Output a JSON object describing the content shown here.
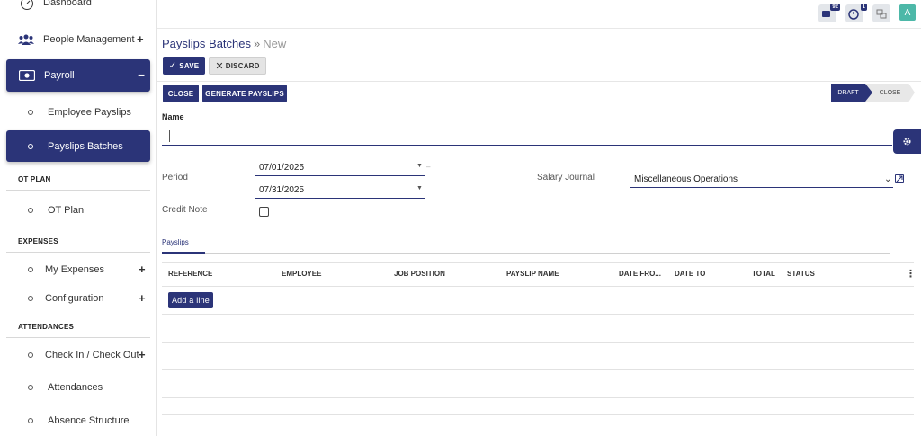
{
  "sidebar": {
    "dashboard": "Dashboard",
    "people_management": "People Management",
    "payroll": "Payroll",
    "employee_payslips": "Employee Payslips",
    "payslips_batches": "Payslips Batches",
    "section_ot_plan": "OT PLAN",
    "ot_plan": "OT Plan",
    "section_expenses": "EXPENSES",
    "my_expenses": "My Expenses",
    "configuration": "Configuration",
    "section_attendances": "ATTENDANCES",
    "check_in_out": "Check In / Check Out",
    "attendances": "Attendances",
    "absence_structure": "Absence Structure",
    "plus": "+",
    "minus": "−"
  },
  "topbar": {
    "messages_badge": "92",
    "activity_badge": "1",
    "avatar_letter": "A"
  },
  "breadcrumb": {
    "parent": "Payslips Batches",
    "separator": "»",
    "current": "New"
  },
  "toolbar": {
    "save": "SAVE",
    "discard": "DISCARD",
    "close": "CLOSE",
    "generate": "GENERATE PAYSLIPS"
  },
  "statusbar": {
    "draft": "DRAFT",
    "close": "CLOSE"
  },
  "form": {
    "name_label": "Name",
    "name_value": "",
    "period_label": "Period",
    "period_start": "07/01/2025",
    "period_end": "07/31/2025",
    "period_dash": "–",
    "credit_note_label": "Credit Note",
    "salary_journal_label": "Salary Journal",
    "salary_journal_value": "Miscellaneous Operations"
  },
  "tabs": {
    "payslips": "Payslips"
  },
  "table": {
    "columns": [
      "REFERENCE",
      "EMPLOYEE",
      "JOB POSITION",
      "PAYSLIP NAME",
      "DATE FRO...",
      "DATE TO",
      "TOTAL",
      "STATUS"
    ],
    "add_line": "Add a line"
  },
  "colors": {
    "primary": "#2b3478",
    "avatar": "#4db8a8"
  }
}
